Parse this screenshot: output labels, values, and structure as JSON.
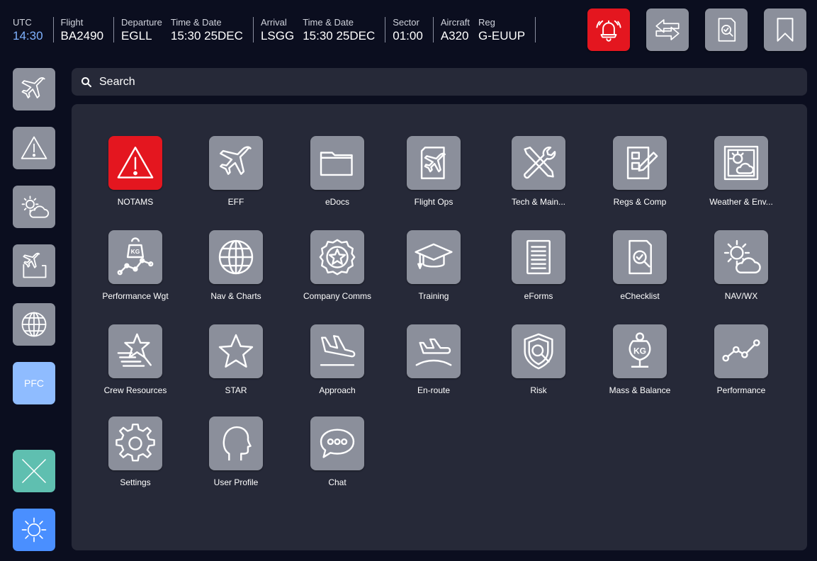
{
  "header": {
    "utc": {
      "label": "UTC",
      "value": "14:30"
    },
    "flight": {
      "label": "Flight",
      "value": "BA2490"
    },
    "departure": {
      "label": "Departure",
      "value": "EGLL"
    },
    "dep_time": {
      "label": "Time & Date",
      "value": "15:30 25DEC"
    },
    "arrival": {
      "label": "Arrival",
      "value": "LSGG"
    },
    "arr_time": {
      "label": "Time & Date",
      "value": "15:30 25DEC"
    },
    "sector": {
      "label": "Sector",
      "value": "01:00"
    },
    "aircraft": {
      "label": "Aircraft",
      "value": "A320"
    },
    "reg": {
      "label": "Reg",
      "value": "G-EUUP"
    },
    "buttons": {
      "alarm": "bell-alarm-icon",
      "swap": "swap-arrows-icon",
      "search_doc": "document-search-icon",
      "bookmark": "bookmark-icon"
    },
    "alarm_color": "#e4161f"
  },
  "sidebar": {
    "items": [
      {
        "icon": "airplane-icon"
      },
      {
        "icon": "warning-icon"
      },
      {
        "icon": "weather-icon"
      },
      {
        "icon": "flight-ops-icon"
      },
      {
        "icon": "globe-icon"
      },
      {
        "label": "PFC"
      },
      {
        "icon": "close-icon"
      },
      {
        "icon": "brightness-icon"
      }
    ]
  },
  "search": {
    "placeholder": "Search"
  },
  "apps": [
    {
      "label": "NOTAMS",
      "icon": "warning-icon"
    },
    {
      "label": "EFF",
      "icon": "airplane-icon"
    },
    {
      "label": "eDocs",
      "icon": "folder-icon"
    },
    {
      "label": "Flight Ops",
      "icon": "flight-ops-icon"
    },
    {
      "label": "Tech & Main...",
      "icon": "tools-icon"
    },
    {
      "label": "Regs & Comp",
      "icon": "form-pen-icon"
    },
    {
      "label": "Weather & Env...",
      "icon": "weather-map-icon"
    },
    {
      "label": "Performance Wgt",
      "icon": "weight-graph-icon"
    },
    {
      "label": "Nav & Charts",
      "icon": "globe-icon"
    },
    {
      "label": "Company Comms",
      "icon": "star-badge-icon"
    },
    {
      "label": "Training",
      "icon": "graduation-cap-icon"
    },
    {
      "label": "eForms",
      "icon": "document-lines-icon"
    },
    {
      "label": "eChecklist",
      "icon": "checklist-search-icon"
    },
    {
      "label": "NAV/WX",
      "icon": "sun-cloud-icon"
    },
    {
      "label": "Crew Resources",
      "icon": "shooting-star-icon"
    },
    {
      "label": "STAR",
      "icon": "star-icon"
    },
    {
      "label": "Approach",
      "icon": "landing-icon"
    },
    {
      "label": "En-route",
      "icon": "enroute-icon"
    },
    {
      "label": "Risk",
      "icon": "shield-search-icon"
    },
    {
      "label": "Mass & Balance",
      "icon": "kg-weight-icon"
    },
    {
      "label": "Performance",
      "icon": "line-graph-icon"
    },
    {
      "label": "Settings",
      "icon": "gear-icon"
    },
    {
      "label": "User Profile",
      "icon": "user-head-icon"
    },
    {
      "label": "Chat",
      "icon": "chat-bubble-icon"
    }
  ]
}
